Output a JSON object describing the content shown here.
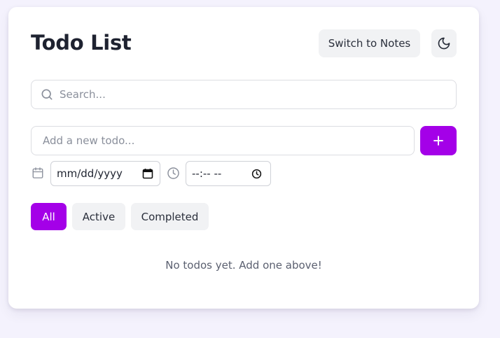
{
  "header": {
    "title": "Todo List",
    "switch_label": "Switch to Notes",
    "theme_icon": "moon-icon"
  },
  "search": {
    "placeholder": "Search...",
    "icon": "search-icon"
  },
  "new_todo": {
    "placeholder": "Add a new todo...",
    "add_icon": "plus-icon"
  },
  "date": {
    "value": "mm/dd/yyyy",
    "icon": "calendar-icon"
  },
  "time": {
    "value": "--:-- --",
    "icon": "clock-icon"
  },
  "filters": {
    "items": [
      {
        "label": "All",
        "active": true
      },
      {
        "label": "Active",
        "active": false
      },
      {
        "label": "Completed",
        "active": false
      }
    ]
  },
  "empty_message": "No todos yet. Add one above!",
  "colors": {
    "accent": "#a400e8",
    "background": "#f4f2fd",
    "card": "#ffffff",
    "muted_button": "#f1f2f4"
  }
}
